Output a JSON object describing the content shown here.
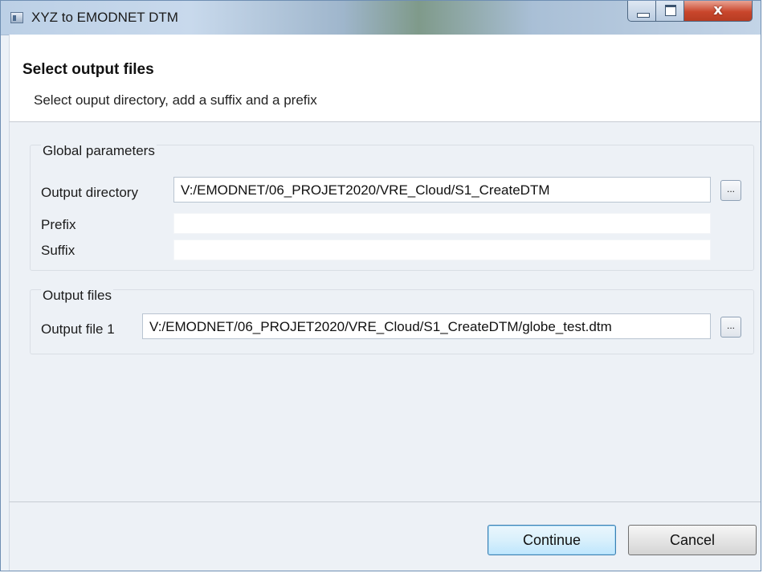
{
  "window": {
    "title": "XYZ to EMODNET DTM",
    "close_label": "x"
  },
  "header": {
    "title": "Select output files",
    "description": "Select ouput directory, add a suffix and a prefix"
  },
  "global_parameters": {
    "legend": "Global parameters",
    "output_directory_label": "Output directory",
    "output_directory_value": "V:/EMODNET/06_PROJET2020/VRE_Cloud/S1_CreateDTM",
    "prefix_label": "Prefix",
    "prefix_value": "",
    "suffix_label": "Suffix",
    "suffix_value": "",
    "browse_label": "..."
  },
  "output_files": {
    "legend": "Output files",
    "file1_label": "Output file 1",
    "file1_value": "V:/EMODNET/06_PROJET2020/VRE_Cloud/S1_CreateDTM/globe_test.dtm",
    "browse_label": "..."
  },
  "buttons": {
    "continue_label": "Continue",
    "cancel_label": "Cancel"
  },
  "colors": {
    "primary_button_border": "#3c7fb1",
    "close_button": "#c9462c"
  }
}
